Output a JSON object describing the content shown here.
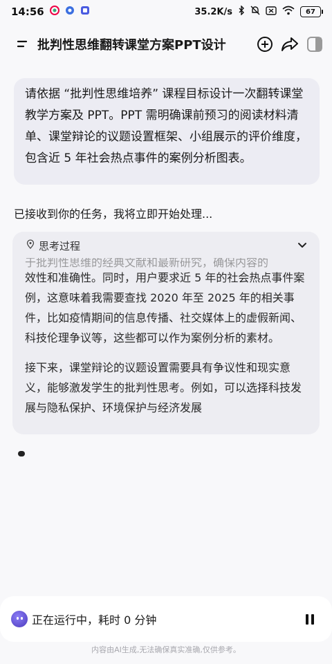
{
  "status_bar": {
    "time": "14:56",
    "network_speed": "35.2K/s",
    "battery": "67"
  },
  "header": {
    "title": "批判性思维翻转课堂方案PPT设计"
  },
  "user_message": {
    "text": "请依据 “批判性思维培养” 课程目标设计一次翻转课堂教学方案及 PPT。PPT 需明确课前预习的阅读材料清单、课堂辩论的议题设置框架、小组展示的评价维度，包含近 5 年社会热点事件的案例分析图表。"
  },
  "assistant": {
    "status_text": "已接收到你的任务，我将立即开始处理..."
  },
  "thinking": {
    "title": "思考过程",
    "partial_line": "于批判性思维的经典文献和最新研究，确保内容的",
    "paragraph_1": "效性和准确性。同时，用户要求近 5 年的社会热点事件案例，这意味着我需要查找 2020 年至 2025 年的相关事件，比如疫情期间的信息传播、社交媒体上的虚假新闻、科技伦理争议等，这些都可以作为案例分析的素材。",
    "paragraph_2": "接下来，课堂辩论的议题设置需要具有争议性和现实意义，能够激发学生的批判性思考。例如，可以选择科技发展与隐私保护、环境保护与经济发展"
  },
  "run_bar": {
    "text": "正在运行中，耗时 0 分钟"
  },
  "footer": {
    "disclaimer": "内容由AI生成,无法确保真实准确,仅供参考。"
  }
}
